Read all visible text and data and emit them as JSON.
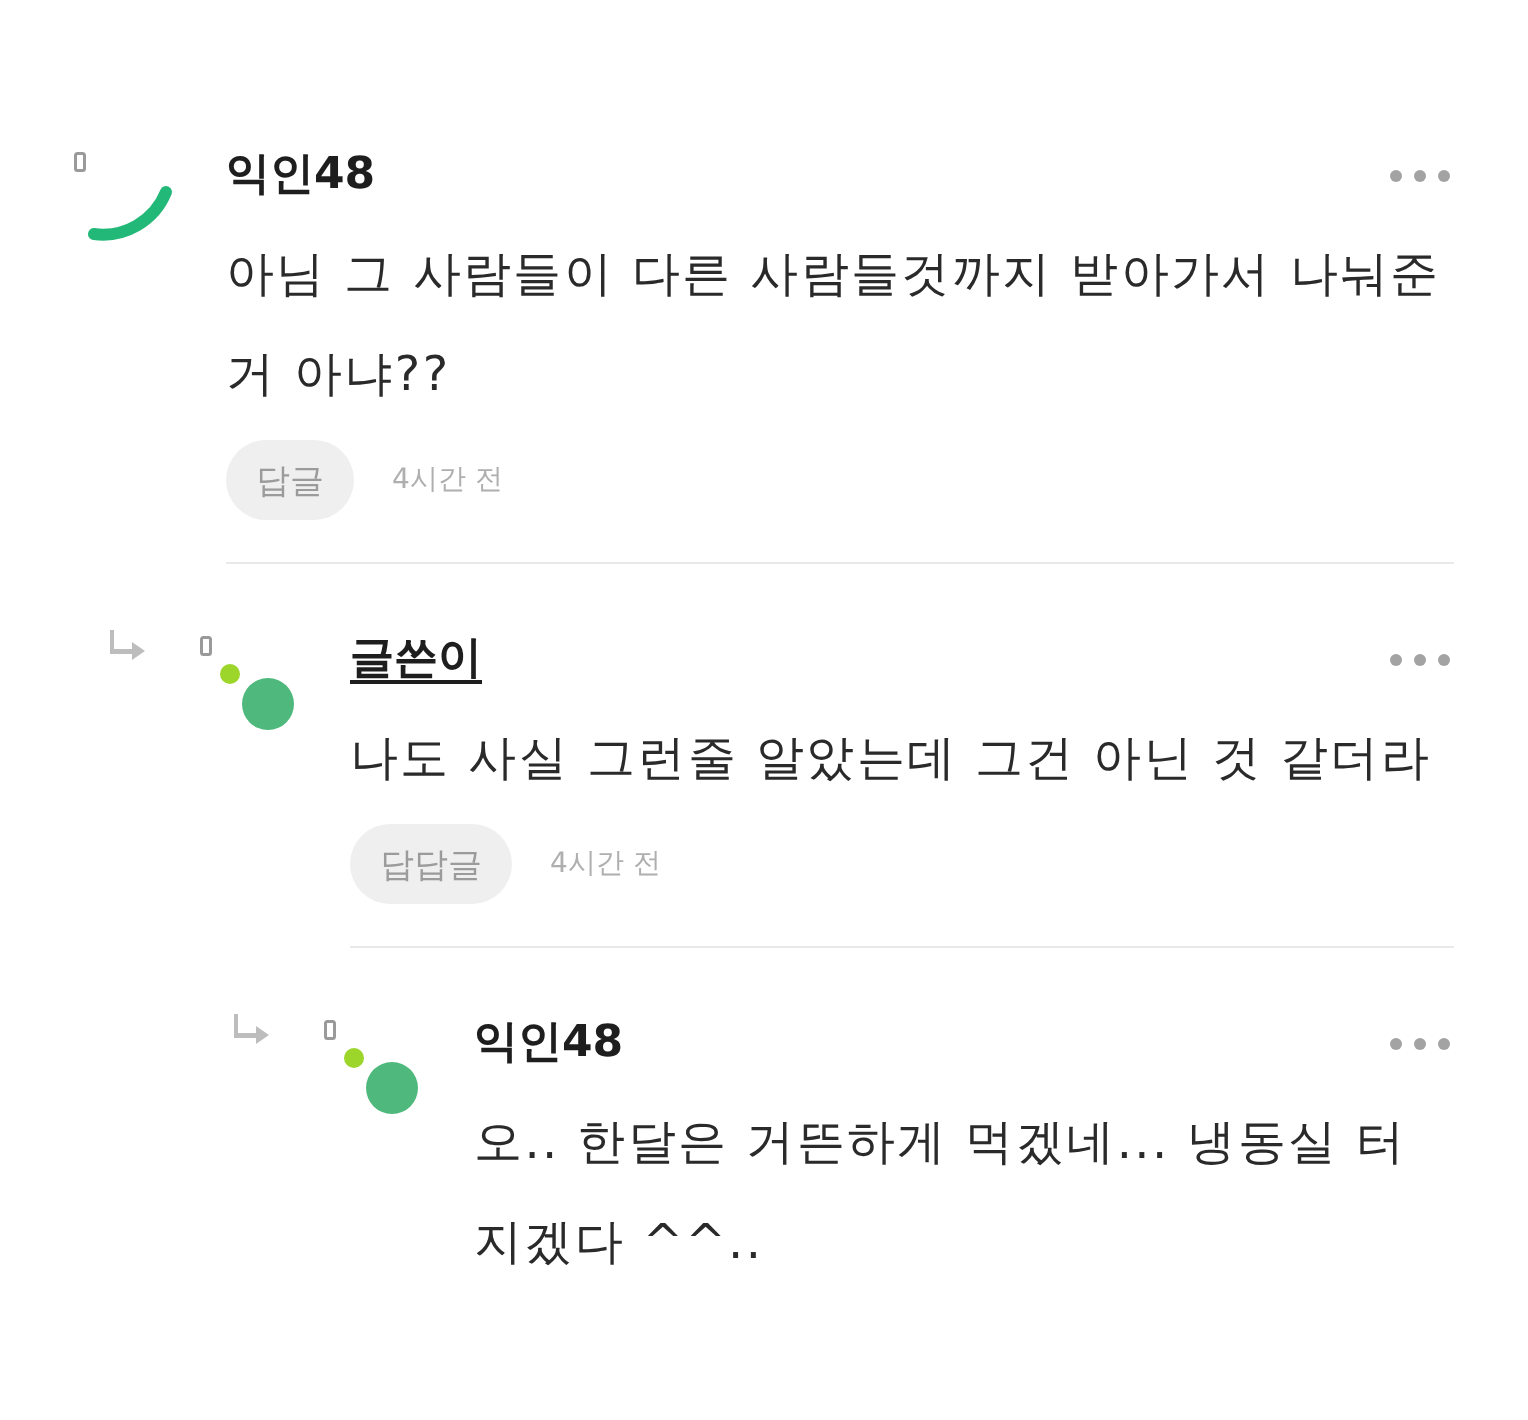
{
  "comments": [
    {
      "author": "익인48",
      "is_writer": false,
      "avatar": {
        "kind": "spinner"
      },
      "body": "아님 그 사람들이 다른 사람들것까지 받아가서 나눠준 거 아냐??",
      "reply_button": "답글",
      "time": "4시간 전",
      "children": [
        {
          "author": "글쓴이",
          "is_writer": true,
          "avatar": {
            "kind": "dots"
          },
          "body": "나도 사실 그런줄 알았는데 그건 아닌 것 같더라",
          "reply_button": "답답글",
          "time": "4시간 전",
          "children": [
            {
              "author": "익인48",
              "is_writer": false,
              "avatar": {
                "kind": "dots"
              },
              "body": "오.. 한달은 거뜬하게 먹겠네... 냉동실 터지겠다 ^^.."
            }
          ]
        }
      ]
    }
  ]
}
